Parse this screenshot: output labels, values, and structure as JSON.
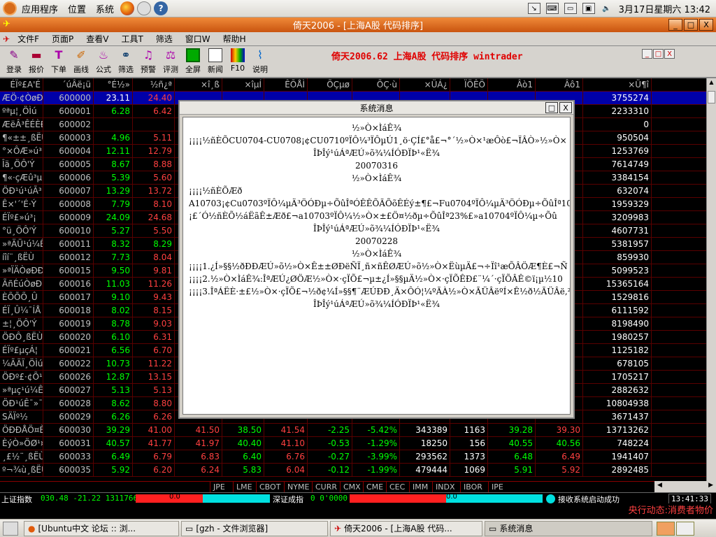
{
  "topbar": {
    "menus": [
      "应用程序",
      "位置",
      "系统"
    ],
    "clock": "3月17日星期六  13:42"
  },
  "window": {
    "title": "倚天2006 - [上海A股 代码排序]",
    "btn_min": "_",
    "btn_max": "□",
    "btn_close": "X"
  },
  "menubar": [
    "文件F",
    "页面P",
    "查看V",
    "工具T",
    "筛选",
    "窗口W",
    "帮助H"
  ],
  "toolbar": {
    "items": [
      "登录",
      "报价",
      "下单",
      "画线",
      "公式",
      "筛选",
      "预警",
      "评测",
      "全屏",
      "新闻",
      "F10",
      "说明"
    ],
    "app_title": "倚天2006.62 上海A股 代码排序 wintrader"
  },
  "grid": {
    "headers": [
      "ÉÏº£A'É",
      "´úÂë¡ü",
      "°É½»",
      "½ñ¿ª",
      "×î¸ß",
      "×îµÍ",
      "ÊÕÅÌ",
      "ÕÇµø",
      "ÕÇ·ù",
      "×ÜÁ¿",
      "ÏÖÊÖ",
      "Âò1",
      "Âô1",
      "×Ü¶î"
    ],
    "rows": [
      [
        "ÆÖ·¢ÒøÐ",
        "600000",
        "23.11",
        "24.40",
        "",
        "",
        "",
        "",
        "",
        "",
        "",
        "",
        "",
        "3755274"
      ],
      [
        "ºªµ¦¸ÖÌú",
        "600001",
        "6.28",
        "6.42",
        "",
        "",
        "",
        "",
        "",
        "",
        "",
        "",
        "",
        "2233310"
      ],
      [
        "ÆëÂ³ÊÉÈÐ",
        "600002",
        "",
        "",
        "",
        "",
        "",
        "",
        "",
        "",
        "",
        "",
        "",
        "0"
      ],
      [
        "¶«±±¸ßËÙ",
        "600003",
        "4.96",
        "5.11",
        "",
        "",
        "",
        "",
        "",
        "",
        "",
        "",
        "",
        "950504"
      ],
      [
        "°×ÔÆ»ú³¡",
        "600004",
        "12.11",
        "12.79",
        "",
        "",
        "",
        "",
        "",
        "",
        "",
        "",
        "",
        "1253769"
      ],
      [
        "Îä¸ÖÔ'Ý",
        "600005",
        "8.67",
        "8.88",
        "",
        "",
        "",
        "",
        "",
        "",
        "",
        "",
        "",
        "7614749"
      ],
      [
        "¶«·çÆû³µ",
        "600006",
        "5.39",
        "5.60",
        "",
        "",
        "",
        "",
        "",
        "",
        "",
        "",
        "",
        "3384154"
      ],
      [
        "ÖÐ¹ú¹úÃ³",
        "600007",
        "13.29",
        "13.72",
        "",
        "",
        "",
        "",
        "",
        "",
        "",
        "",
        "",
        "632074"
      ],
      [
        "Ê×'´'É·Ý",
        "600008",
        "7.79",
        "8.10",
        "",
        "",
        "",
        "",
        "",
        "",
        "",
        "",
        "",
        "1959329"
      ],
      [
        "ÉÏº£»ú³¡",
        "600009",
        "24.09",
        "24.68",
        "",
        "",
        "",
        "",
        "",
        "",
        "",
        "",
        "",
        "3209983"
      ],
      [
        "°ü¸ÖÔ'Ý",
        "600010",
        "5.27",
        "5.50",
        "",
        "",
        "",
        "",
        "",
        "",
        "",
        "",
        "",
        "4607731"
      ],
      [
        "»ªÄÜ¹ú¼Ê",
        "600011",
        "8.32",
        "8.29",
        "",
        "",
        "",
        "",
        "",
        "",
        "",
        "",
        "",
        "5381957"
      ],
      [
        "íîí¨¸ßËÙ",
        "600012",
        "7.73",
        "8.04",
        "",
        "",
        "",
        "",
        "",
        "",
        "",
        "",
        "",
        "859930"
      ],
      [
        "»ªÏÄÒøÐÐ",
        "600015",
        "9.50",
        "9.81",
        "",
        "",
        "",
        "",
        "",
        "",
        "",
        "",
        "",
        "5099523"
      ],
      [
        "ÃñÉúÒøÐ",
        "600016",
        "11.03",
        "11.26",
        "",
        "",
        "",
        "",
        "",
        "",
        "",
        "",
        "",
        "15365164"
      ],
      [
        "ÈÕÕÕ¸Û",
        "600017",
        "9.10",
        "9.43",
        "",
        "",
        "",
        "",
        "",
        "",
        "",
        "",
        "",
        "1529816"
      ],
      [
        "ÉÏ¸Û¼¯ÍÅ",
        "600018",
        "8.02",
        "8.15",
        "",
        "",
        "",
        "",
        "",
        "",
        "",
        "",
        "",
        "6111592"
      ],
      [
        "±¦¸ÖÔ'Ý",
        "600019",
        "8.78",
        "9.03",
        "",
        "",
        "",
        "",
        "",
        "",
        "",
        "",
        "",
        "8198490"
      ],
      [
        "ÖÐÔ­¸ßËÙ",
        "600020",
        "6.10",
        "6.31",
        "",
        "",
        "",
        "",
        "",
        "",
        "",
        "",
        "",
        "1980257"
      ],
      [
        "ÉÏº£µçÁ¦",
        "600021",
        "6.56",
        "6.70",
        "",
        "",
        "",
        "",
        "",
        "",
        "",
        "",
        "",
        "1125182"
      ],
      [
        "¼ÃÄÏ¸ÖÌú",
        "600022",
        "10.73",
        "11.22",
        "",
        "",
        "",
        "",
        "",
        "",
        "",
        "",
        "",
        "678105"
      ],
      [
        "ÖÐº£·¢Õ¹",
        "600026",
        "12.87",
        "13.15",
        "",
        "",
        "",
        "",
        "",
        "",
        "",
        "",
        "",
        "1705217"
      ],
      [
        "»ªµç¹ú¼Ê",
        "600027",
        "5.13",
        "5.13",
        "",
        "",
        "",
        "",
        "",
        "",
        "",
        "",
        "",
        "2882632"
      ],
      [
        "ÖÐ¹úÊ¯»¯",
        "600028",
        "8.62",
        "8.80",
        "",
        "",
        "",
        "",
        "",
        "",
        "",
        "",
        "",
        "10804938"
      ],
      [
        "SÄÏº½",
        "600029",
        "6.26",
        "6.26",
        "",
        "",
        "",
        "",
        "",
        "",
        "",
        "",
        "",
        "3671437"
      ],
      [
        "ÖÐÐÅÖ¤È¯",
        "600030",
        "39.29",
        "41.00",
        "41.50",
        "38.50",
        "41.54",
        "-2.25",
        "-5.42%",
        "343389",
        "1163",
        "39.28",
        "39.30",
        "13713262"
      ],
      [
        "ÈýÒ»ÖØ¹¤",
        "600031",
        "40.57",
        "41.77",
        "41.97",
        "40.40",
        "41.10",
        "-0.53",
        "-1.29%",
        "18250",
        "156",
        "40.55",
        "40.56",
        "748224"
      ],
      [
        "¸£½¨¸ßËÙ",
        "600033",
        "6.49",
        "6.79",
        "6.83",
        "6.40",
        "6.76",
        "-0.27",
        "-3.99%",
        "293562",
        "1373",
        "6.48",
        "6.49",
        "1941407"
      ],
      [
        "º¬¾ù¸ßËÙ",
        "600035",
        "5.92",
        "6.20",
        "6.24",
        "5.83",
        "6.04",
        "-0.12",
        "-1.99%",
        "479444",
        "1069",
        "5.91",
        "5.92",
        "2892485"
      ]
    ]
  },
  "tabs": [
    "JPE",
    "LME",
    "CBOT",
    "NYME",
    "CURR",
    "CMX",
    "CME",
    "CEC",
    "IMM",
    "INDX",
    "IBOR",
    "IPE"
  ],
  "status": {
    "sh_label": "上证指数",
    "sh_value": "030.48 -21.22 131176688",
    "sh_bar_value": "0.0",
    "sz_label": "深证成指",
    "sz_value": "0 0'0000",
    "sz_bar_value": "0.0",
    "connect": "接收系统启动成功",
    "time": "13:41:33"
  },
  "news": "央行动态:消费者物价",
  "dialog": {
    "title": "系统消息",
    "lines": [
      "½»Ò×ÌáÊ¾",
      "¡¡¡¡½ñÈÕCU0704-CU0708¡¢CU0710ºÏÔ¼³ÏÔµÚ1¸ö·ÇÍ£°å£¬°´½»Ò×¹æÔò£¬ÏÂÒ»½»Ò×",
      "ÎÞÎý¹úÁªÆÚ»õ¾­¼ÍÓÐÏÞ¹«Ë¾",
      "20070316",
      "½»Ò×ÌáÊ¾",
      "¡¡¡¡½ñÈÕÆð",
      "A10703¡¢Cu0703ºÏÔ¼µÄ³ÖÓÐµ÷ÕûÎªÓÊÊÕÃÕõÊÉý±¶£¬Fu0704ºÏÔ¼µÄ³ÖÓÐµ÷ÕûÎª10ÊÉ",
      "¡£´Ó½ñÈÕ½áËãÊ±Æð£¬a10703ºÏÔ¼½»Ò×±£Ö¤½ðµ÷ÕûÎª23%£»a10704ºÏÔ¼µ÷Õû",
      "ÎÞÎý¹úÁªÆÚ»õ¾­¼ÍÓÐÏÞ¹«Ë¾",
      "20070228",
      "½»Ò×ÌáÊ¾",
      "¡¡¡¡1.¿Í»§§½ðÐÐÆÚ»õ½»Ò×Ê±±ØÐëÑÏ¸ñ×ñÊØÆÚ»õ½»Ò×ËùµÄ£¬÷Ïî¹æÕÂÖÆ¶È£¬Ñ",
      "¡¡¡¡2.½»Ò×ÌáÊ¾:ÎªÆÚ¿ØÖÆ½»Ò×·çÏÕ£¬µ±¿Í»§§µÄ½»Ò×·çÏÕÊÐ£¨¼´·çÏÕÂÊ©ï¡µ½10",
      "¡¡¡¡3.ÎªÁËÈ·±£½»Ò×·çÏÕ£¬½ð¢¼Í»§§¶¨ÆÚÐÐ¸Ä×ÔÓ¦¼ºÃÀ½»Ò×ÃÜÂëºÍ×Ê½ð½ÃÜÂë,²»Òª°",
      "ÎÞÎý¹úÁªÆÚ»õ¾­¼ÍÓÐÏÞ¹«Ë¾"
    ]
  },
  "taskbar": [
    "[Ubuntu中文 论坛 :: 浏...",
    "[gzh - 文件浏览器]",
    "倚天2006 - [上海A股 代码...",
    "系统消息"
  ],
  "colors": {
    "up": "#ff4040",
    "down": "#00ff00",
    "highlight": "#0000a8",
    "title_orange": "#e0661c"
  }
}
